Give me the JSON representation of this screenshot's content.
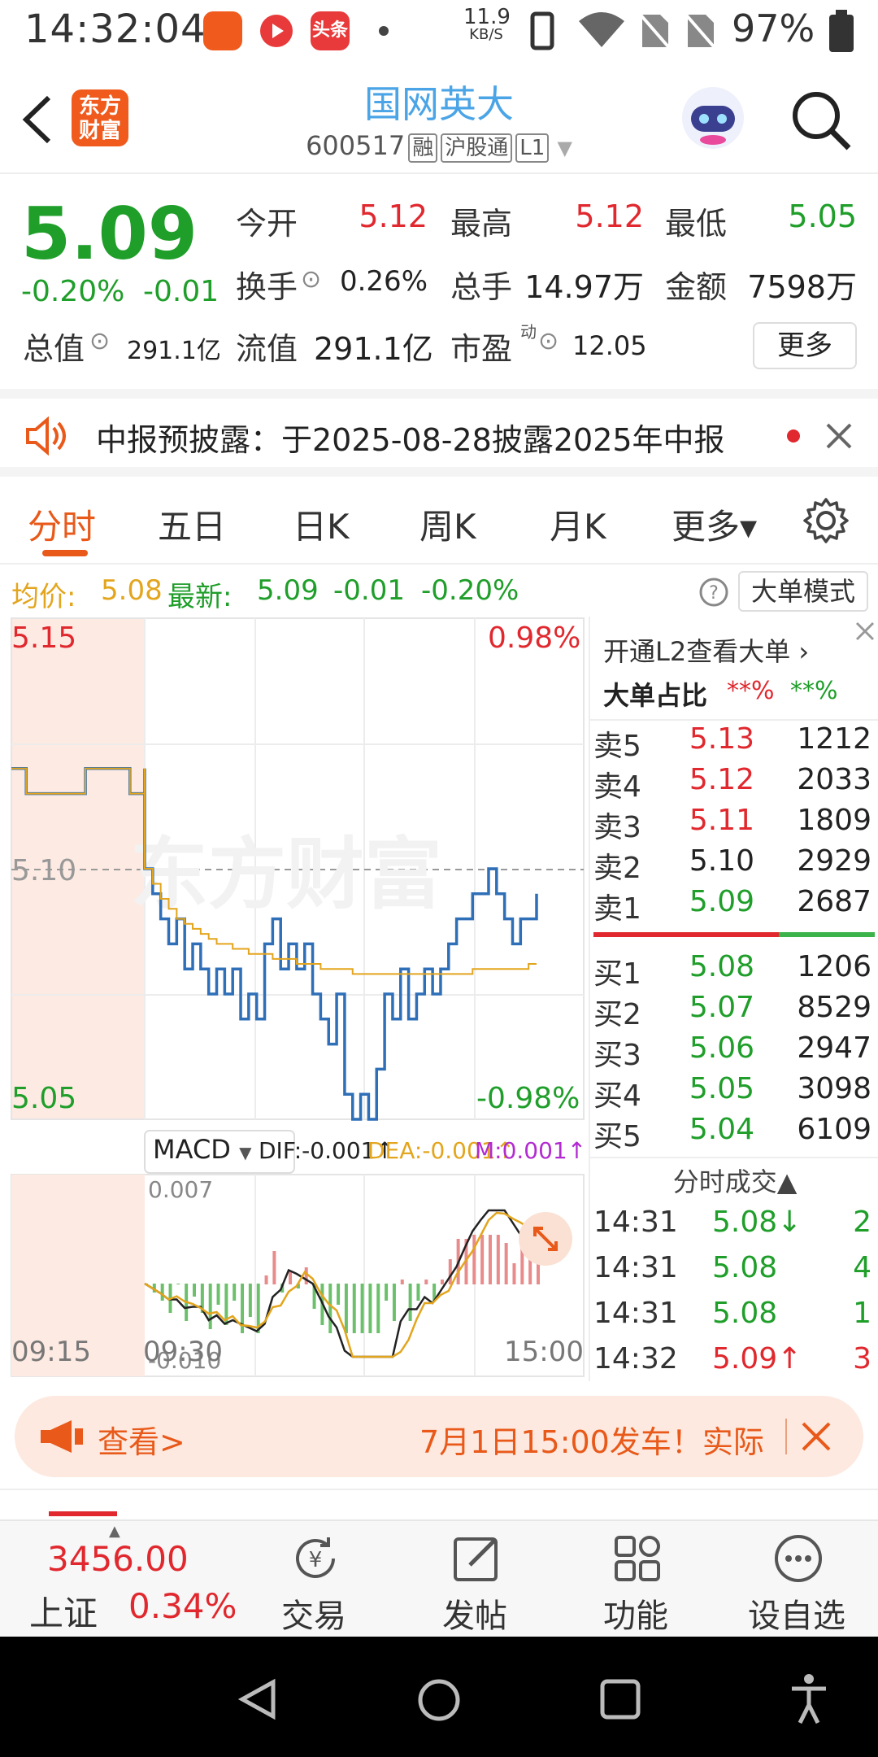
{
  "status_bar": {
    "time": "14:32:04",
    "speed_value": "11.9",
    "speed_unit": "KB/S",
    "battery": "97%",
    "icons": [
      "app-notification-icon",
      "video-app-icon",
      "toutiao-app-icon",
      "dot-icon",
      "phone-icon",
      "wifi-icon",
      "no-sim-icon",
      "no-sim-icon",
      "battery-icon"
    ],
    "toutiao_label": "头条"
  },
  "header": {
    "logo_text_line1": "东方",
    "logo_text_line2": "财富",
    "stock_name": "国网英大",
    "stock_code": "600517",
    "tag_rong": "融",
    "tag_hgt": "沪股通",
    "tag_level": "L1"
  },
  "quote": {
    "price": "5.09",
    "change_pct": "-0.20%",
    "change_abs": "-0.01",
    "open_label": "今开",
    "open_value": "5.12",
    "high_label": "最高",
    "high_value": "5.12",
    "low_label": "最低",
    "low_value": "5.05",
    "turnover_label": "换手",
    "turnover_value": "0.26%",
    "volume_label": "总手",
    "volume_value": "14.97万",
    "amount_label": "金额",
    "amount_value": "7598万",
    "mktcap_label": "总值",
    "mktcap_value": "291.1亿",
    "float_label": "流值",
    "float_value": "291.1亿",
    "pe_label": "市盈",
    "pe_sup": "动",
    "pe_value": "12.05",
    "more_button": "更多"
  },
  "notice": {
    "text": "中报预披露：于2025-08-28披露2025年中报"
  },
  "tabs": [
    {
      "label": "分时",
      "active": true
    },
    {
      "label": "五日",
      "active": false
    },
    {
      "label": "日K",
      "active": false
    },
    {
      "label": "周K",
      "active": false
    },
    {
      "label": "月K",
      "active": false
    },
    {
      "label": "更多▾",
      "active": false
    }
  ],
  "info_line": {
    "avg_label": "均价:",
    "avg_value": "5.08",
    "latest_label": "最新:",
    "latest_value": "5.09",
    "latest_change": "-0.01",
    "latest_pct": "-0.20%",
    "mode_button": "大单模式"
  },
  "chart_data": {
    "type": "line",
    "ylim": [
      5.05,
      5.15
    ],
    "y_top_label": "5.15",
    "y_mid_label": "5.10",
    "y_bottom_label": "5.05",
    "pct_top_label": "0.98%",
    "pct_bottom_label": "-0.98%",
    "x_tick_labels": [
      "09:15",
      "09:30",
      "15:00"
    ],
    "watermark": "东方财富",
    "series": [
      {
        "name": "price",
        "color": "#2f6fb8",
        "values": [
          5.12,
          5.115,
          5.115,
          5.115,
          5.115,
          5.12,
          5.12,
          5.12,
          5.115,
          5.12,
          5.1,
          5.095,
          5.09,
          5.085,
          5.09,
          5.08,
          5.085,
          5.08,
          5.075,
          5.08,
          5.075,
          5.08,
          5.07,
          5.075,
          5.07,
          5.085,
          5.09,
          5.08,
          5.085,
          5.08,
          5.085,
          5.075,
          5.07,
          5.065,
          5.075,
          5.055,
          5.05,
          5.055,
          5.05,
          5.06,
          5.075,
          5.07,
          5.08,
          5.07,
          5.075,
          5.08,
          5.075,
          5.08,
          5.085,
          5.09,
          5.09,
          5.095,
          5.095,
          5.1,
          5.095,
          5.09,
          5.085,
          5.09,
          5.09,
          5.095
        ]
      },
      {
        "name": "average",
        "color": "#e3a51d",
        "values": [
          5.12,
          5.115,
          5.115,
          5.115,
          5.115,
          5.12,
          5.12,
          5.12,
          5.115,
          5.12,
          5.1,
          5.097,
          5.094,
          5.092,
          5.09,
          5.089,
          5.088,
          5.087,
          5.086,
          5.085,
          5.085,
          5.084,
          5.084,
          5.083,
          5.083,
          5.083,
          5.082,
          5.082,
          5.082,
          5.081,
          5.081,
          5.081,
          5.08,
          5.08,
          5.08,
          5.08,
          5.079,
          5.079,
          5.079,
          5.079,
          5.079,
          5.079,
          5.079,
          5.079,
          5.079,
          5.079,
          5.079,
          5.079,
          5.079,
          5.079,
          5.079,
          5.08,
          5.08,
          5.08,
          5.08,
          5.08,
          5.08,
          5.08,
          5.081,
          5.081
        ]
      }
    ],
    "macd": {
      "label": "MACD",
      "dif_label": "DIF:-0.001",
      "dea_label": "DEA:-0.001",
      "m_label": "M:0.001",
      "top_label": "0.007",
      "bottom_label": "-0.010"
    }
  },
  "order_book": {
    "promo_text": "开通L2查看大单",
    "ratio_label": "大单占比",
    "ratio_sell": "**%",
    "ratio_buy": "**%",
    "asks": [
      {
        "label": "卖5",
        "price": "5.13",
        "vol": "1212",
        "color": "red"
      },
      {
        "label": "卖4",
        "price": "5.12",
        "vol": "2033",
        "color": "red"
      },
      {
        "label": "卖3",
        "price": "5.11",
        "vol": "1809",
        "color": "red"
      },
      {
        "label": "卖2",
        "price": "5.10",
        "vol": "2929",
        "color": "black"
      },
      {
        "label": "卖1",
        "price": "5.09",
        "vol": "2687",
        "color": "green"
      }
    ],
    "bids": [
      {
        "label": "买1",
        "price": "5.08",
        "vol": "1206",
        "color": "green"
      },
      {
        "label": "买2",
        "price": "5.07",
        "vol": "8529",
        "color": "green"
      },
      {
        "label": "买3",
        "price": "5.06",
        "vol": "2947",
        "color": "green"
      },
      {
        "label": "买4",
        "price": "5.05",
        "vol": "3098",
        "color": "green"
      },
      {
        "label": "买5",
        "price": "5.04",
        "vol": "6109",
        "color": "green"
      }
    ],
    "ratio_bar_red_fraction": 0.66,
    "trades_header": "分时成交▲",
    "trades": [
      {
        "time": "14:31",
        "price": "5.08↓",
        "vol": "2",
        "color": "green"
      },
      {
        "time": "14:31",
        "price": "5.08",
        "vol": "4",
        "color": "green"
      },
      {
        "time": "14:31",
        "price": "5.08",
        "vol": "1",
        "color": "green"
      },
      {
        "time": "14:32",
        "price": "5.09↑",
        "vol": "3",
        "color": "red"
      }
    ]
  },
  "banner": {
    "left_text": "查看>",
    "right_text": "7月1日15:00发车！实际"
  },
  "bottom_nav": {
    "index_value": "3456.00",
    "index_name": "上证",
    "index_pct": "0.34%",
    "items": [
      "交易",
      "发帖",
      "功能",
      "设自选"
    ]
  }
}
